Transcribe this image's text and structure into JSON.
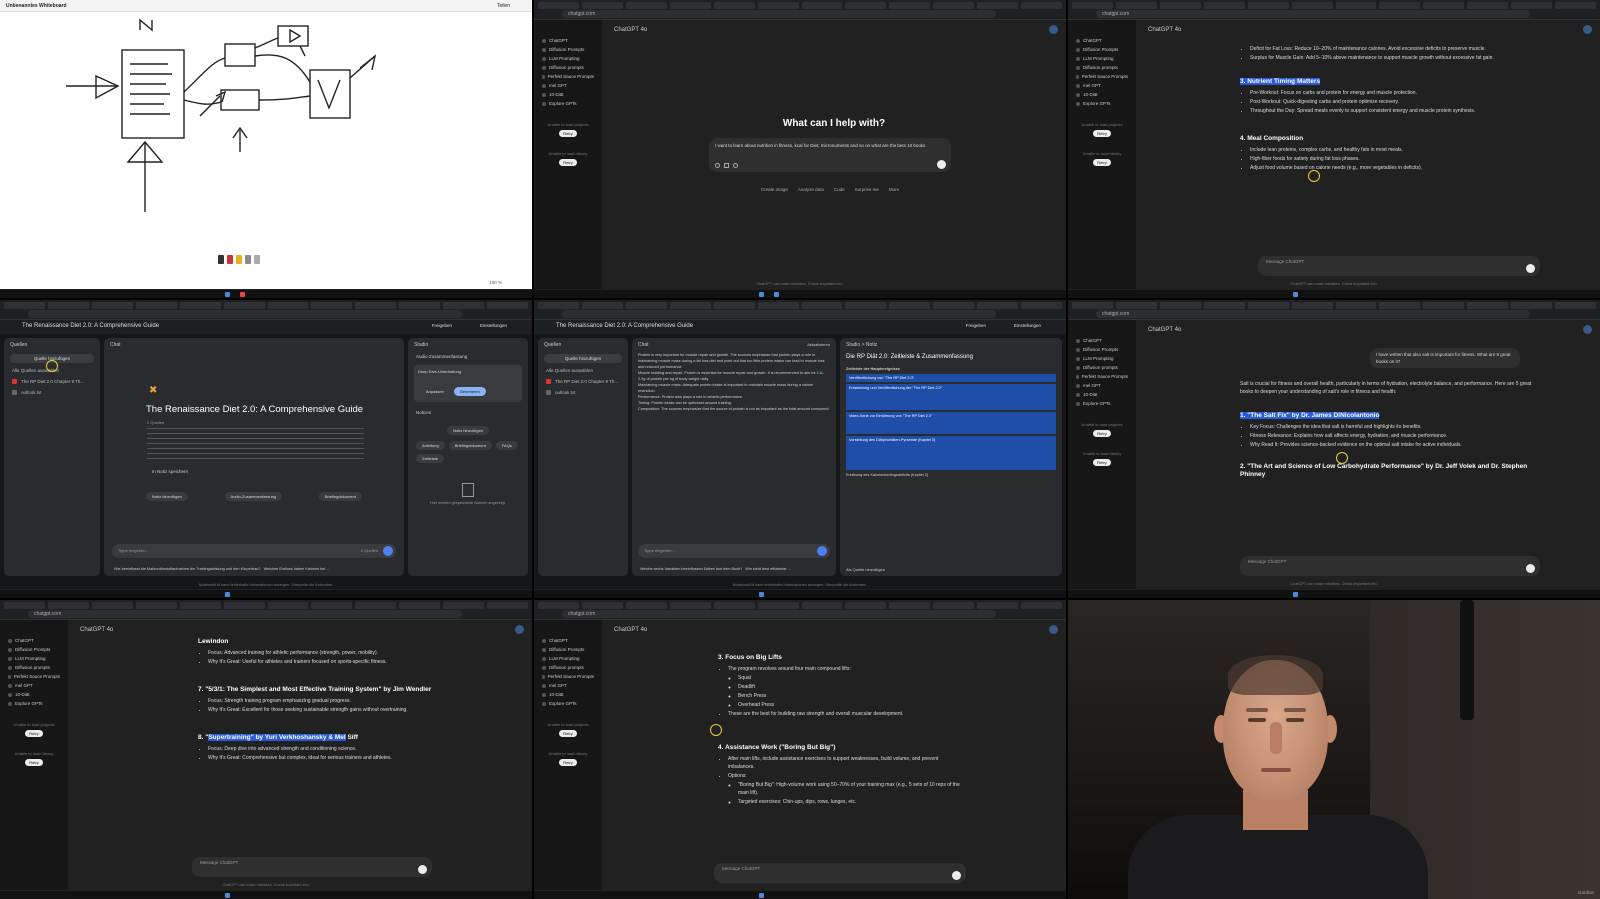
{
  "tile1": {
    "title": "Unbenanntes Whiteboard",
    "share": "Teilen",
    "zoom": "100 %"
  },
  "tile2": {
    "url": "chatgpt.com",
    "model": "ChatGPT 4o",
    "sidebar": [
      "ChatGPT",
      "Diffusion Prompts",
      "LLM Prompting",
      "Diffusion prompts",
      "Perfekt Sauce Prompts",
      "mel GPT",
      "10-Diät",
      "Explore GPTs"
    ],
    "note_projects": "Unable to load projects",
    "note_history": "Unable to load history",
    "retry": "Retry",
    "heading": "What can I help with?",
    "input_text": "I want to learn about nutrition in fitness, kcal for Diet, micronutrients and so on what are the bets 10 books",
    "chips": [
      "Create image",
      "Analyze data",
      "Code",
      "Surprise me",
      "More"
    ],
    "footer": "ChatGPT can make mistakes. Check important info."
  },
  "tile3": {
    "items_top": [
      "Deficit for Fat Loss: Reduce 10–20% of maintenance calories. Avoid excessive deficits to preserve muscle.",
      "Surplus for Muscle Gain: Add 5–10% above maintenance to support muscle growth without excessive fat gain."
    ],
    "h3": "3. Nutrient Timing Matters",
    "h3_items": [
      "Pre-Workout: Focus on carbs and protein for energy and muscle protection.",
      "Post-Workout: Quick-digesting carbs and protein optimize recovery.",
      "Throughout the Day: Spread meals evenly to support consistent energy and muscle protein synthesis."
    ],
    "h4": "4. Meal Composition",
    "h4_items": [
      "Include lean proteins, complex carbs, and healthy fats in most meals.",
      "High-fiber foods for satiety during fat loss phases.",
      "Adjust food volume based on calorie needs (e.g., more vegetables in deficits)."
    ],
    "message_placeholder": "Message ChatGPT"
  },
  "tile4": {
    "title": "The Renaissance Diet 2.0: A Comprehensive Guide",
    "share": "Freigeben",
    "settings": "Einstellungen",
    "sources_title": "Quellen",
    "add_source": "Quelle hinzufügen",
    "select_all": "Alle Quellen auswählen",
    "sources": [
      "The RP Diet 2.0 Chapter 9 Th...",
      "outlook.txt"
    ],
    "chat_title": "Chat",
    "guide_title": "The Renaissance Diet 2.0: A Comprehensive Guide",
    "guide_sources": "2 Quellen",
    "save_note": "In Notiz speichern",
    "actions": [
      "Notiz hinzufügen",
      "Audio-Zusammenfassung",
      "Briefingdokument"
    ],
    "input_placeholder": "Tippe eingeben...",
    "input_count": "2 Quellen",
    "suggestion1": "Wie beeinflusst die Makronährstoffaufnahme die Trainingsleistung und den Körperbau?",
    "suggestion2": "Welchen Einfluss haben Kalorien bei ...",
    "studio_title": "Studio",
    "audio_title": "Audio-Zusammenfassung",
    "deep_dive": "Deep Dive-Unterhaltung",
    "customize": "Anpassen",
    "generate": "Generieren",
    "notes_title": "Notizen",
    "add_note": "Notiz hinzufügen",
    "note_buttons": [
      "Anleitung",
      "Briefingdokument",
      "FAQs",
      "Zeitleiste"
    ],
    "notes_empty": "Hier werden gespeicherte Notizen angezeigt.",
    "disclaimer": "NotebookLM kann fehlerhafte Informationen anzeigen. Überprüfe die Antworten."
  },
  "tile5": {
    "title": "The Renaissance Diet 2.0: A Comprehensive Guide",
    "chat_title": "Chat",
    "refresh": "Aktualisieren",
    "studio_path": "Studio > Notiz",
    "note_title": "Die RP Diät 2.0: Zeitleiste & Zusammenfassung",
    "chat_paragraphs": [
      "Protein is very important for muscle repair and growth. The sources emphasize that protein plays a role in maintaining muscle mass during a fat loss diet and point out that too little protein intake can lead to muscle loss and reduced performance.",
      "Muscle building and repair: Protein is essential for muscle repair and growth. It is recommended to aim for 1.6–2.2g of protein per kg of body weight daily.",
      "Maintaining muscle mass: Adequate protein intake is important to maintain muscle mass during a calorie restriction.",
      "Performance: Protein also plays a role in athletic performance.",
      "Timing: Protein intake can be optimized around training.",
      "Composition: The sources emphasize that the source of protein is not as important as the total amount consumed."
    ],
    "chat_input": "Tippe eingeben...",
    "suggestion1": "Welche sechs Variablen beeinflussen Diäten laut dem Buch?",
    "suggestion2": "Wie sieht best effizienter ...",
    "note_lines": [
      "Zeitleiste der Hauptereignisse",
      "Veröffentlichung von \"The RP Diet 2.0\"",
      "Entwicklung und Veröffentlichung der \"The RP Diet 2.0\"",
      "Video-Serie zur Einführung von \"The RP Diet 2.0\"",
      "Vorstellung des Diätprioritäten-Pyramide (Kapitel 5)",
      "Erklärung des Kalorienbedingedefizits (Kapitel 2)"
    ],
    "add_source": "Als Quelle hinzufügen"
  },
  "tile6": {
    "user_msg": "I have written that also salt is important for fitness. What are 5 great books on it?",
    "intro": "Salt is crucial for fitness and overall health, particularly in terms of hydration, electrolyte balance, and performance. Here are 5 great books to deepen your understanding of salt's role in fitness and health:",
    "b1_title_pre": "1. \"The Salt Fix\" by Dr. James DiNicolantonio",
    "b1_items": [
      "Key Focus: Challenges the idea that salt is harmful and highlights its benefits.",
      "Fitness Relevance: Explains how salt affects energy, hydration, and muscle performance.",
      "Why Read It: Provides science-backed evidence on the optimal salt intake for active individuals."
    ],
    "b2_title": "2. \"The Art and Science of Low Carbohydrate Performance\" by Dr. Jeff Volek and Dr. Stephen Phinney",
    "message_placeholder": "Message ChatGPT"
  },
  "tile7": {
    "top_title": "Lewindon",
    "top_items": [
      "Focus: Advanced training for athletic performance (strength, power, mobility).",
      "Why It's Great: Useful for athletes and trainers focused on sports-specific fitness."
    ],
    "h7": "7. \"5/3/1: The Simplest and Most Effective Training System\" by Jim Wendler",
    "h7_items": [
      "Focus: Strength training program emphasizing gradual progress.",
      "Why It's Great: Excellent for those seeking sustainable strength gains without overtraining."
    ],
    "h8_pre": "8. \"",
    "h8_hl": "Supertraining\" by Yuri Verkhoshansky & Mel",
    "h8_post": " Siff",
    "h8_items": [
      "Focus: Deep dive into advanced strength and conditioning science.",
      "Why It's Great: Comprehensive but complex, ideal for serious trainers and athletes."
    ],
    "message_placeholder": "Message ChatGPT"
  },
  "tile8": {
    "h3": "3. Focus on Big Lifts",
    "intro": "The program revolves around four main compound lifts:",
    "lifts": [
      "Squat",
      "Deadlift",
      "Bench Press",
      "Overhead Press"
    ],
    "after": "These are the best for building raw strength and overall muscular development.",
    "h4": "4. Assistance Work (\"Boring But Big\")",
    "h4_items": [
      "After main lifts, include assistance exercises to support weaknesses, build volume, and prevent imbalances.",
      "Options:"
    ],
    "options": [
      "\"Boring But Big\": High-volume work using 50–70% of your training max (e.g., 5 sets of 10 reps of the main lift).",
      "Targeted exercises: Chin-ups, dips, rows, lunges, etc."
    ],
    "message_placeholder": "Message ChatGPT"
  },
  "tile9": {
    "watermark": "Gordion"
  },
  "colors": {
    "highlight": "#2a5bd7",
    "chat_bg": "#212121",
    "sidebar_bg": "#171717",
    "cursor": "#e8d23a"
  }
}
